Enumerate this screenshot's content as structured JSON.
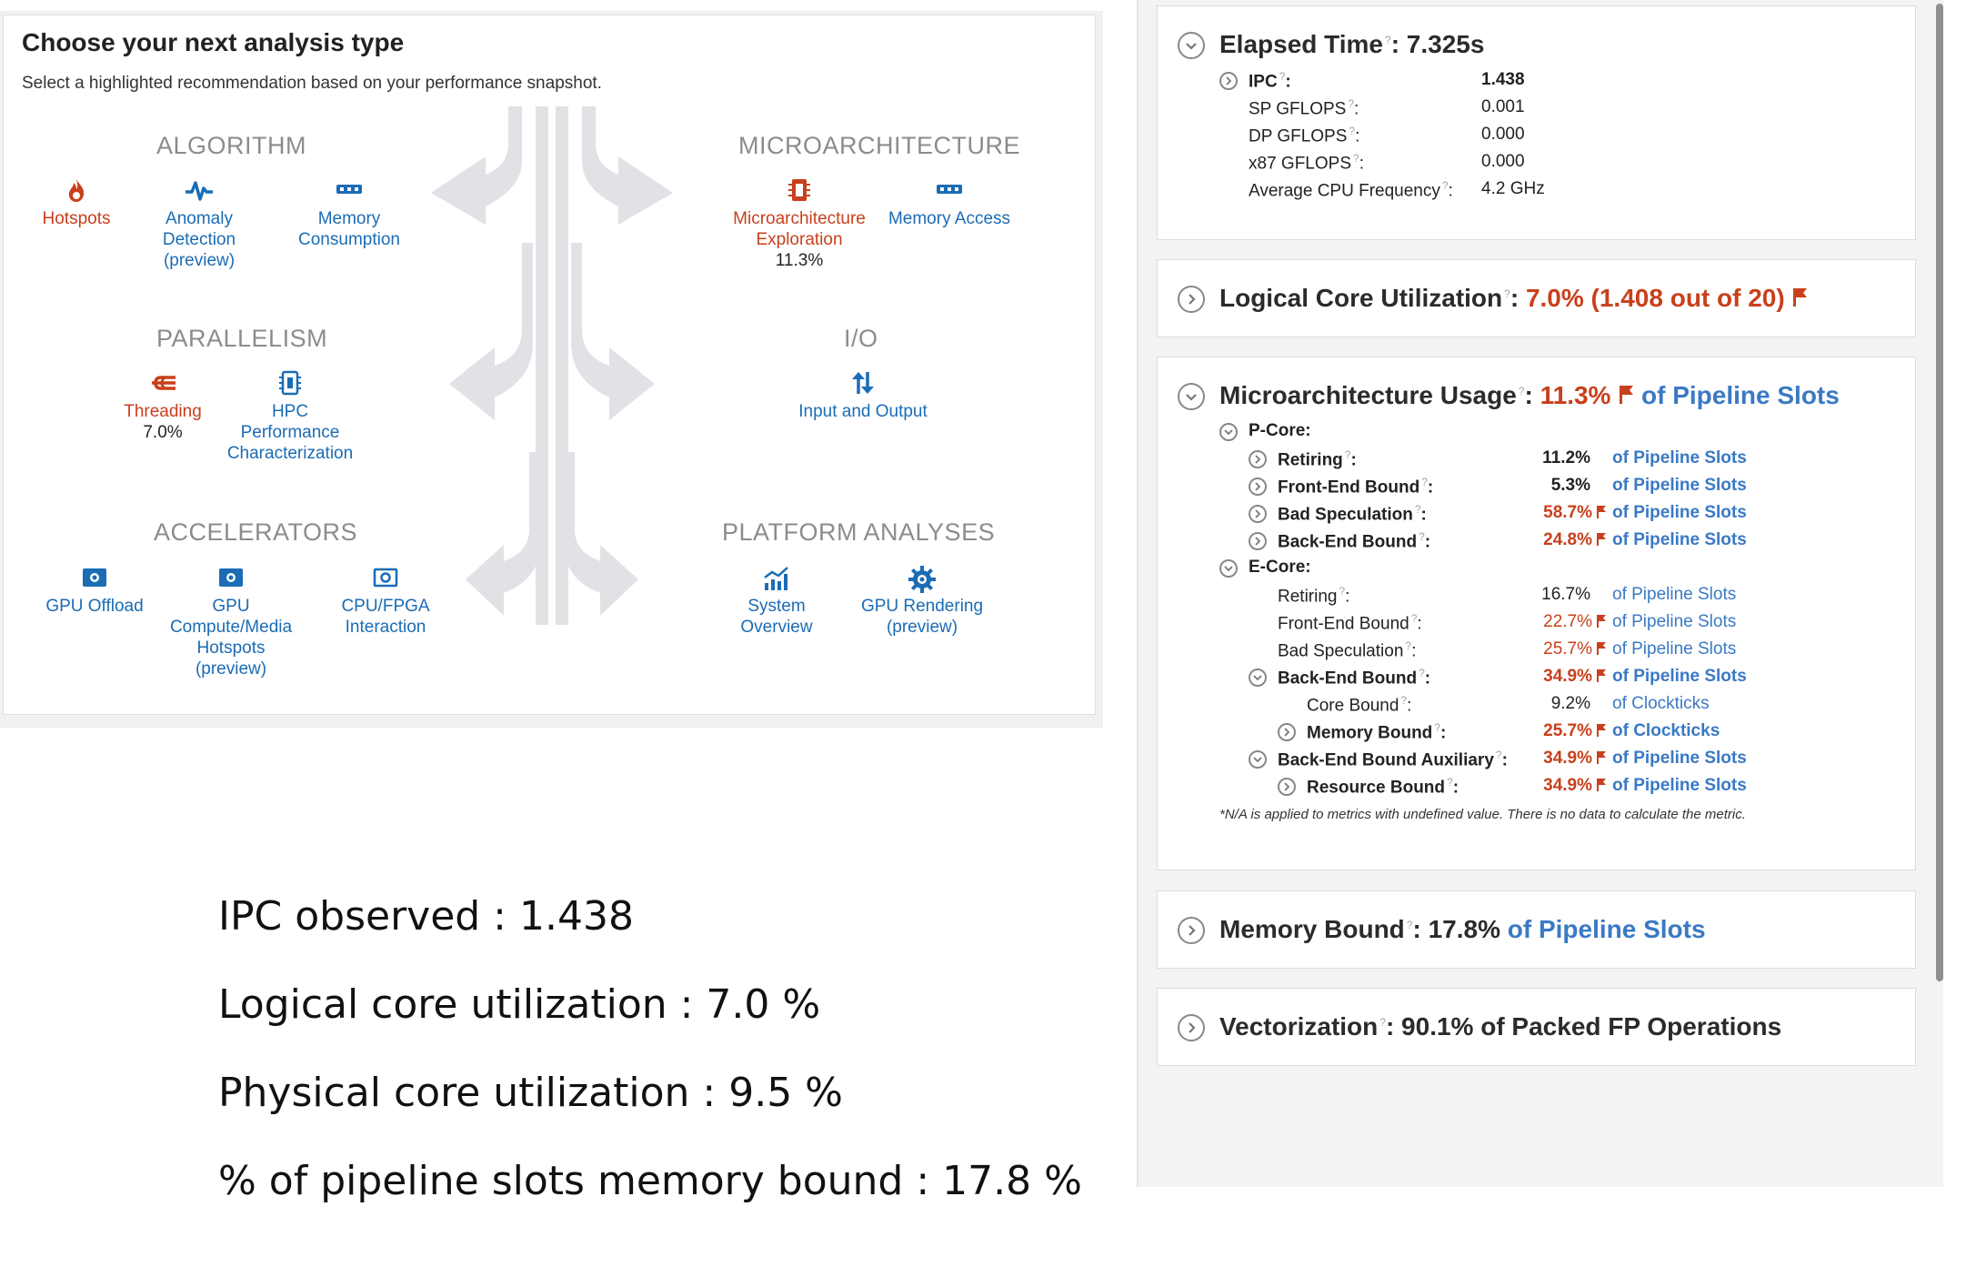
{
  "analysis_panel": {
    "title": "Choose your next analysis type",
    "subtitle": "Select a highlighted recommendation based on your performance snapshot.",
    "categories": {
      "algorithm": "ALGORITHM",
      "parallelism": "PARALLELISM",
      "accelerators": "ACCELERATORS",
      "microarchitecture": "MICROARCHITECTURE",
      "io": "I/O",
      "platform": "PLATFORM ANALYSES"
    },
    "tools": {
      "hotspots": "Hotspots",
      "anomaly": [
        "Anomaly",
        "Detection",
        "(preview)"
      ],
      "memory_consumption": [
        "Memory",
        "Consumption"
      ],
      "threading": "Threading",
      "threading_pct": "7.0%",
      "hpc": [
        "HPC",
        "Performance",
        "Characterization"
      ],
      "gpu_offload": "GPU Offload",
      "gpu_compute": [
        "GPU",
        "Compute/Media",
        "Hotspots",
        "(preview)"
      ],
      "cpu_fpga": [
        "CPU/FPGA",
        "Interaction"
      ],
      "uarch_exploration": [
        "Microarchitecture",
        "Exploration"
      ],
      "uarch_exploration_pct": "11.3%",
      "memory_access": "Memory Access",
      "input_output": "Input and Output",
      "system_overview": [
        "System",
        "Overview"
      ],
      "gpu_rendering": [
        "GPU Rendering",
        "(preview)"
      ]
    }
  },
  "elapsed": {
    "label": "Elapsed Time",
    "value": ": 7.325s",
    "metrics": [
      {
        "label": "IPC",
        "value": "1.438"
      },
      {
        "label": "SP GFLOPS",
        "value": "0.001"
      },
      {
        "label": "DP GFLOPS",
        "value": "0.000"
      },
      {
        "label": "x87 GFLOPS",
        "value": "0.000"
      },
      {
        "label": "Average CPU Frequency",
        "value": "4.2 GHz"
      }
    ]
  },
  "logical_core": {
    "label": "Logical Core Utilization",
    "colon": ": ",
    "value": "7.0% (1.408 out of 20)"
  },
  "uarch_usage": {
    "label": "Microarchitecture Usage",
    "colon": ": ",
    "value": "11.3%",
    "unit": "of Pipeline Slots",
    "pcore_label": "P-Core:",
    "ecore_label": "E-Core:",
    "rows": [
      {
        "label": "Retiring",
        "value": "11.2%",
        "unit": "of Pipeline Slots"
      },
      {
        "label": "Front-End Bound",
        "value": "5.3%",
        "unit": "of Pipeline Slots"
      },
      {
        "label": "Bad Speculation",
        "value": "58.7%",
        "unit": "of Pipeline Slots"
      },
      {
        "label": "Back-End Bound",
        "value": "24.8%",
        "unit": "of Pipeline Slots"
      },
      {
        "label": "Retiring",
        "value": "16.7%",
        "unit": "of Pipeline Slots"
      },
      {
        "label": "Front-End Bound",
        "value": "22.7%",
        "unit": "of Pipeline Slots"
      },
      {
        "label": "Bad Speculation",
        "value": "25.7%",
        "unit": "of Pipeline Slots"
      },
      {
        "label": "Back-End Bound",
        "value": "34.9%",
        "unit": "of Pipeline Slots"
      },
      {
        "label": "Core Bound",
        "value": "9.2%",
        "unit": "of Clockticks"
      },
      {
        "label": "Memory Bound",
        "value": "25.7%",
        "unit": "of Clockticks"
      },
      {
        "label": "Back-End Bound Auxiliary",
        "value": "34.9%",
        "unit": "of Pipeline Slots"
      },
      {
        "label": "Resource Bound",
        "value": "34.9%",
        "unit": "of Pipeline Slots"
      }
    ],
    "note": "*N/A is applied to metrics with undefined value. There is no data to calculate the metric."
  },
  "memory_bound": {
    "label": "Memory Bound",
    "value": ": 17.8% ",
    "unit": "of Pipeline Slots"
  },
  "vectorization": {
    "label": "Vectorization",
    "value": ": 90.1% of Packed FP Operations"
  },
  "summary": {
    "ipc": "IPC observed : 1.438",
    "logical": "Logical core utilization : 7.0 %",
    "physical": "Physical core utilization : 9.5 %",
    "memory": "% of pipeline slots memory bound : 17.8 %"
  },
  "colors": {
    "accent_blue": "#1b6cb5",
    "warn_red": "#c8401c",
    "muted_gray": "#8c8c8c"
  },
  "icons": [
    "flame-icon",
    "pulse-icon",
    "memory-chip-icon",
    "threading-icon",
    "hpc-chip-icon",
    "gpu-card-icon",
    "fpga-card-icon",
    "cpu-chip-icon",
    "io-arrows-icon",
    "chart-icon",
    "gear-icon",
    "expand-chevron-icon",
    "flag-icon",
    "help-icon"
  ]
}
